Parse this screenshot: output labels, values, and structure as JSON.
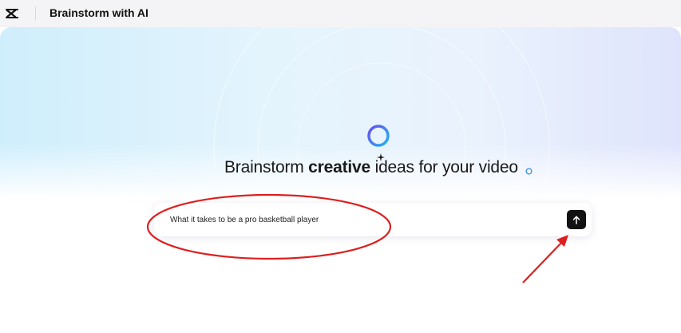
{
  "header": {
    "app_title": "Brainstorm with AI",
    "logo_icon": "capcut-logo-icon"
  },
  "hero": {
    "headline_part1": "Brainstorm ",
    "headline_bold": "creative",
    "headline_part2": " ideas for your video"
  },
  "prompt": {
    "value": "What it takes to be a pro basketball player",
    "send_icon": "arrow-up-icon"
  },
  "colors": {
    "annotation_red": "#dd1f1f",
    "send_button": "#121212",
    "orb_gradient_start": "#5b5cf0",
    "orb_gradient_end": "#22b8f0"
  }
}
